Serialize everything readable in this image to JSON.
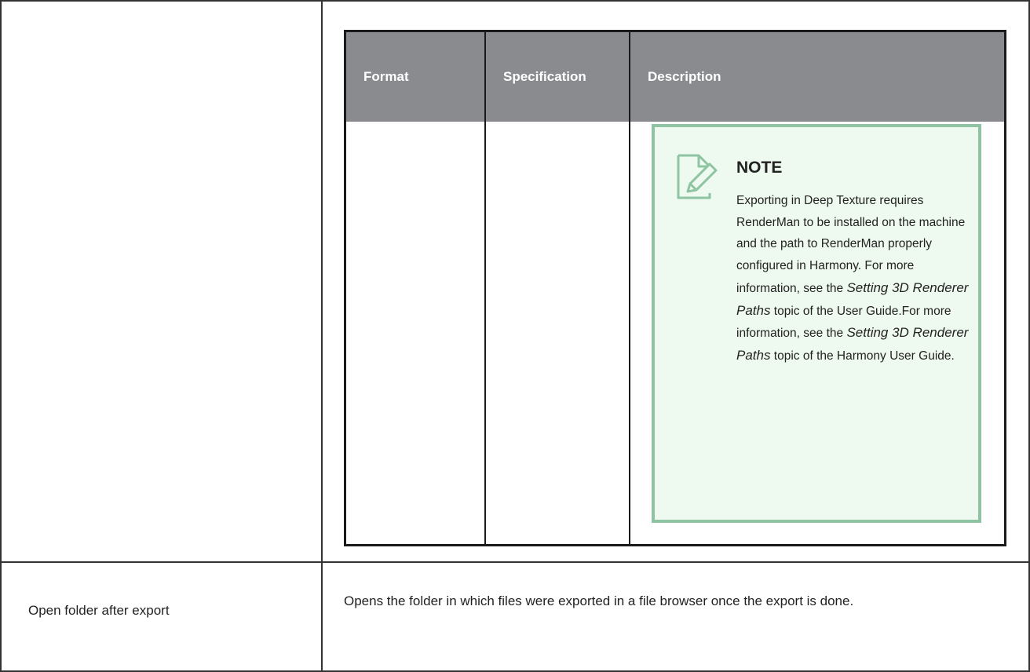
{
  "table": {
    "headers": [
      "Format",
      "Specification",
      "Description"
    ]
  },
  "note": {
    "icon": "note-pencil-icon",
    "title": "NOTE",
    "text_a": "Exporting in Deep Texture requires RenderMan to be installed on the machine and the path to RenderMan properly configured in Harmony. For more information, see the ",
    "link_a": "Setting 3D Renderer Paths",
    "text_b": " topic of the User Guide.For more information, see the ",
    "link_b": "Setting 3D Renderer Paths",
    "text_c": " topic of the Harmony User Guide."
  },
  "row2": {
    "label": "Open folder after export",
    "description": "Opens the folder in which files were exported in a file browser once the export is done."
  },
  "colors": {
    "header_bg": "#8a8b8e",
    "note_border": "#8fc4a3",
    "note_bg": "#eefaef"
  }
}
